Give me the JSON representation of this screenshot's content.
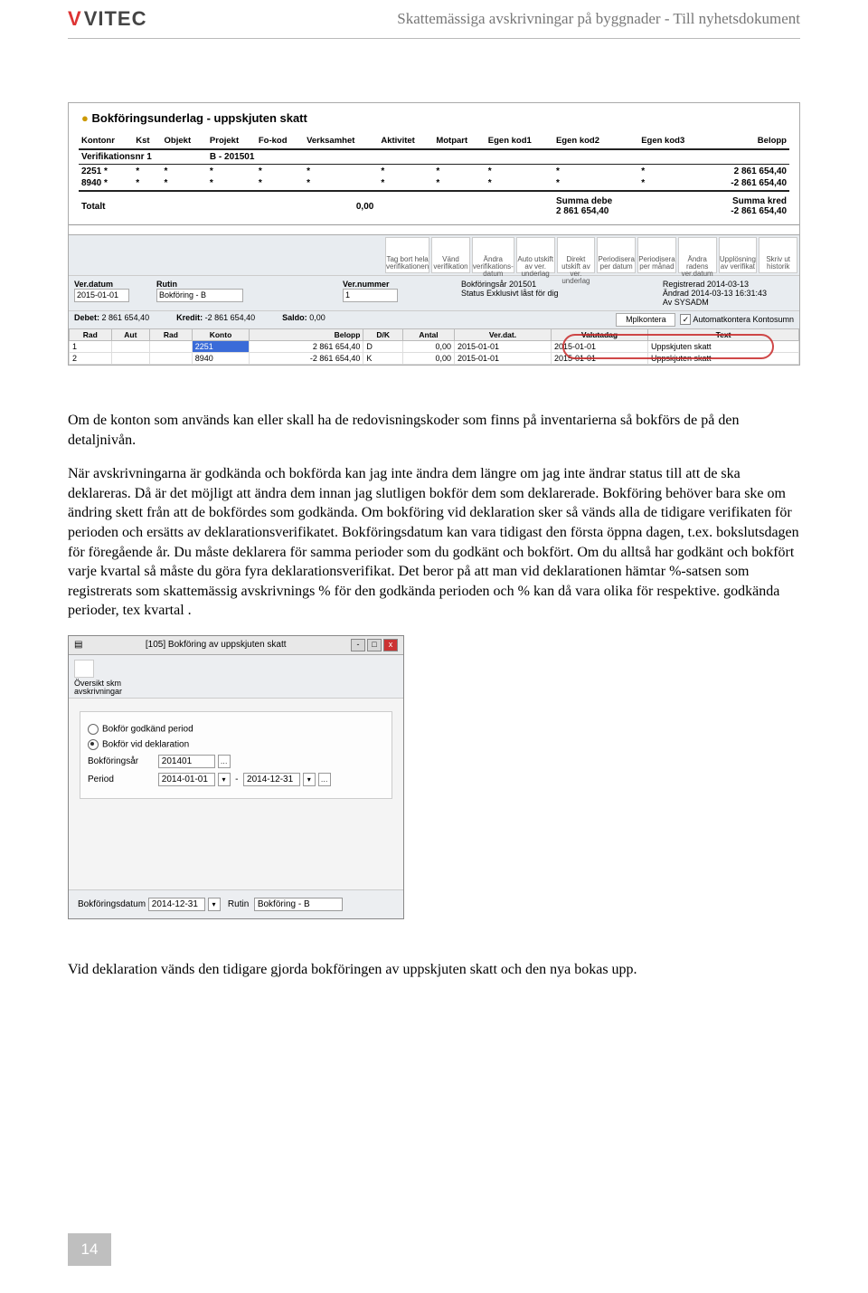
{
  "header": {
    "logo": "VITEC",
    "title": "Skattemässiga avskrivningar på byggnader - Till nyhetsdokument"
  },
  "fig1": {
    "title": "Bokföringsunderlag - uppskjuten skatt",
    "cols": [
      "Kontonr",
      "Kst",
      "Objekt",
      "Projekt",
      "Fo-kod",
      "Verksamhet",
      "Aktivitet",
      "Motpart",
      "Egen kod1",
      "Egen kod2",
      "Egen kod3",
      "Belopp"
    ],
    "ver_label": "Verifikationsnr 1",
    "ver_meta": "B  -  201501",
    "rows": [
      {
        "konto": "2251",
        "belopp": "2 861 654,40"
      },
      {
        "konto": "8940",
        "belopp": "-2 861 654,40"
      }
    ],
    "totalt": "Totalt",
    "totv": "0,00",
    "sd_lbl": "Summa debe",
    "sd_val": "2 861 654,40",
    "sk_lbl": "Summa kred",
    "sk_val": "-2 861 654,40",
    "toolbar": [
      "Tag bort hela verifikationen",
      "Vänd verifikation",
      "Ändra verifikations-datum",
      "Auto utskift av ver. underlag",
      "Direkt utskift av ver. underlag",
      "Periodisera per datum",
      "Periodisera per månad",
      "Ändra radens ver.datum",
      "Upplösning av verifikat",
      "Skriv ut historik"
    ],
    "meta": {
      "verdatum_l": "Ver.datum",
      "verdatum": "2015-01-01",
      "rutin_l": "Rutin",
      "rutin": "Bokföring - B",
      "vernr_l": "Ver.nummer",
      "vernr": "1",
      "bokfar_l": "Bokföringsår",
      "bokfar": "201501",
      "status_l": "Status",
      "status": "Exklusivt låst för dig",
      "reg_l": "Registrerad",
      "reg": "2014-03-13",
      "and_l": "Ändrad",
      "and": "2014-03-13 16:31:43",
      "av_l": "Av",
      "av": "SYSADM"
    },
    "sum": {
      "debet_l": "Debet:",
      "debet": "2 861 654,40",
      "kredit_l": "Kredit:",
      "kredit": "-2 861 654,40",
      "saldo_l": "Saldo:",
      "saldo": "0,00",
      "btn": "Mplkontera",
      "auto": "Automatkontera   Kontosumn"
    },
    "ghdr": [
      "Rad",
      "Aut",
      "Rad",
      "Konto",
      "Belopp",
      "D/K",
      "Antal",
      "Ver.dat.",
      "Valutadag",
      "Text"
    ],
    "grows": [
      {
        "r": "1",
        "konto": "2251",
        "bel": "2 861 654,40",
        "dk": "D",
        "ant": "0,00",
        "vd": "2015-01-01",
        "vdag": "2015-01-01",
        "txt": "Uppskjuten skatt"
      },
      {
        "r": "2",
        "konto": "8940",
        "bel": "-2 861 654,40",
        "dk": "K",
        "ant": "0,00",
        "vd": "2015-01-01",
        "vdag": "2015-01-01",
        "txt": "Uppskjuten skatt"
      }
    ]
  },
  "para1": "Om de konton som används kan eller skall ha de redovisningskoder som finns på inventarierna så bokförs de på den detaljnivån.",
  "para2": "När avskrivningarna är godkända och bokförda kan jag inte ändra dem längre om jag inte ändrar status till att de ska deklareras. Då är det möjligt att ändra dem innan jag slutligen bokför dem som deklarerade. Bokföring behöver bara ske om ändring skett från att de bokfördes som godkända. Om bokföring vid deklaration sker så vänds alla de tidigare verifikaten för perioden och ersätts av deklarationsverifikatet. Bokföringsdatum kan vara tidigast den första öppna dagen, t.ex. bokslutsdagen för föregående år.  Du måste deklarera för samma perioder som du godkänt och bokfört. Om du alltså har godkänt och bokfört varje kvartal så måste du göra fyra deklarationsverifikat. Det beror på att man vid deklarationen hämtar %-satsen som registrerats som skattemässig avskrivnings % för den godkända perioden och %  kan då vara olika för respektive. godkända perioder, tex kvartal .",
  "fig2": {
    "title": "[105] Bokföring av uppskjuten skatt",
    "tool": "Översikt skm avskrivningar",
    "r1": "Bokför godkänd period",
    "r2": "Bokför vid deklaration",
    "bokar_l": "Bokföringsår",
    "bokar": "201401",
    "period_l": "Period",
    "p1": "2014-01-01",
    "p2": "2014-12-31",
    "bd_l": "Bokföringsdatum",
    "bd": "2014-12-31",
    "rutin_l": "Rutin",
    "rutin": "Bokföring - B"
  },
  "para3": "Vid deklaration vänds den tidigare gjorda bokföringen av uppskjuten skatt och den nya bokas upp.",
  "pagenum": "14"
}
